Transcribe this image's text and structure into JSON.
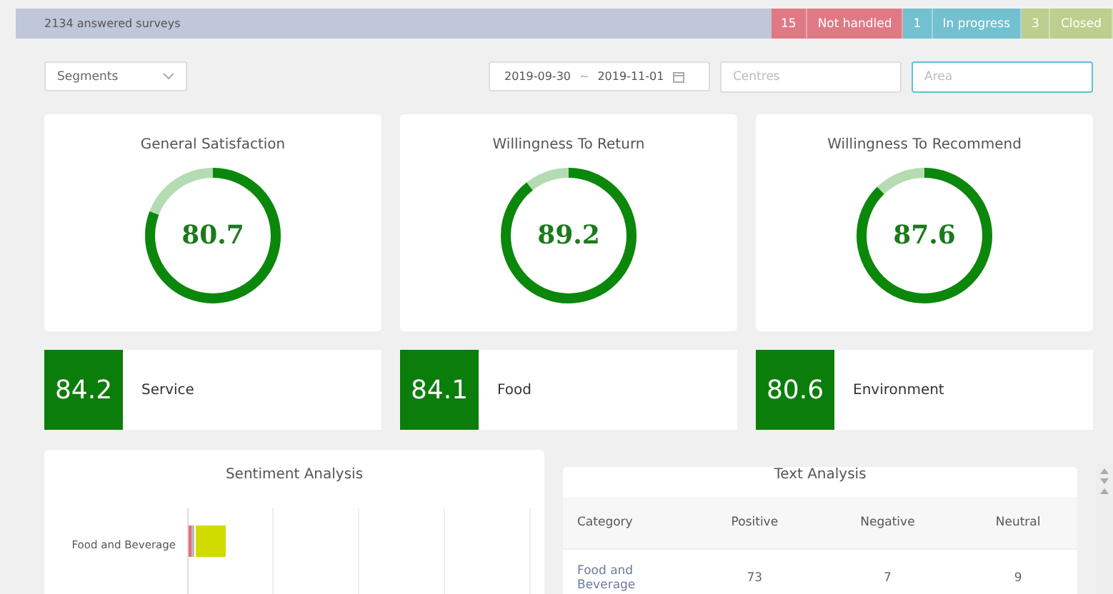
{
  "summary_bar": {
    "answered": "2134 answered surveys",
    "statuses": [
      {
        "count": "15",
        "label": "Not handled",
        "color": "#df7a84"
      },
      {
        "count": "1",
        "label": "In progress",
        "color": "#73c0d0"
      },
      {
        "count": "3",
        "label": "Closed",
        "color": "#bccf8e"
      }
    ]
  },
  "filters": {
    "segments": {
      "label": "Segments"
    },
    "date_range": {
      "from": "2019-09-30",
      "separator": "~",
      "to": "2019-11-01"
    },
    "centres": {
      "placeholder": "Centres"
    },
    "area": {
      "placeholder": "Area",
      "selected": true
    }
  },
  "gauges": [
    {
      "title": "General Satisfaction",
      "value": "80.7",
      "level": 0.807
    },
    {
      "title": "Willingness To Return",
      "value": "89.2",
      "level": 0.892
    },
    {
      "title": "Willingness To Recommend",
      "value": "87.6",
      "level": 0.876
    }
  ],
  "scores": [
    {
      "value": "84.2",
      "label": "Service"
    },
    {
      "value": "84.1",
      "label": "Food"
    },
    {
      "value": "80.6",
      "label": "Environment"
    }
  ],
  "sentiment_analysis": {
    "title": "Sentiment Analysis",
    "categories": [
      "Food and Beverage"
    ]
  },
  "text_analysis": {
    "title": "Text Analysis",
    "columns": [
      "Category",
      "Positive",
      "Negative",
      "Neutral"
    ],
    "rows": [
      [
        "Food and Beverage",
        "73",
        "7",
        "9"
      ]
    ]
  }
}
